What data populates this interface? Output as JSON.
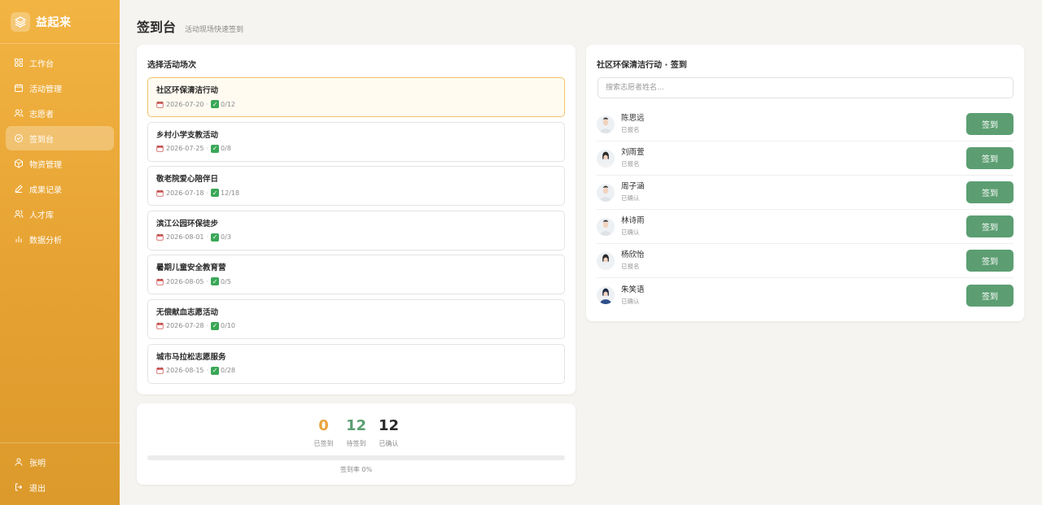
{
  "brand": {
    "name": "益起来",
    "logo_icon": "layers-icon"
  },
  "nav": {
    "items": [
      {
        "label": "工作台",
        "icon": "grid-icon",
        "active": false
      },
      {
        "label": "活动管理",
        "icon": "calendar-icon",
        "active": false
      },
      {
        "label": "志愿者",
        "icon": "users-icon",
        "active": false
      },
      {
        "label": "签到台",
        "icon": "check-circle-icon",
        "active": true
      },
      {
        "label": "物资管理",
        "icon": "box-icon",
        "active": false
      },
      {
        "label": "成果记录",
        "icon": "pen-icon",
        "active": false
      },
      {
        "label": "人才库",
        "icon": "users-icon",
        "active": false
      },
      {
        "label": "数据分析",
        "icon": "bar-chart-icon",
        "active": false
      }
    ]
  },
  "user": {
    "name": "张明",
    "logout_label": "退出"
  },
  "header": {
    "title": "签到台",
    "subtitle": "活动现场快速签到"
  },
  "events": {
    "title": "选择活动场次",
    "items": [
      {
        "name": "社区环保清洁行动",
        "date": "2026-07-20",
        "count": "0/12",
        "selected": true
      },
      {
        "name": "乡村小学支教活动",
        "date": "2026-07-25",
        "count": "0/8",
        "selected": false
      },
      {
        "name": "敬老院爱心陪伴日",
        "date": "2026-07-18",
        "count": "12/18",
        "selected": false
      },
      {
        "name": "滨江公园环保徒步",
        "date": "2026-08-01",
        "count": "0/3",
        "selected": false
      },
      {
        "name": "暑期儿童安全教育营",
        "date": "2026-08-05",
        "count": "0/5",
        "selected": false
      },
      {
        "name": "无偿献血志愿活动",
        "date": "2026-07-28",
        "count": "0/10",
        "selected": false
      },
      {
        "name": "城市马拉松志愿服务",
        "date": "2026-08-15",
        "count": "0/28",
        "selected": false
      }
    ],
    "separator": "·"
  },
  "stats": {
    "checked_in": {
      "value": "0",
      "label": "已签到",
      "color": "#e9a23b"
    },
    "pending": {
      "value": "12",
      "label": "待签到",
      "color": "#5c9e72"
    },
    "confirmed": {
      "value": "12",
      "label": "已确认",
      "color": "#2b2b2b"
    },
    "rate_label": "签到率 0%",
    "rate": 0
  },
  "checkin": {
    "title": "社区环保清洁行动 · 签到",
    "search_placeholder": "搜索志愿者姓名...",
    "button_label": "签到",
    "volunteers": [
      {
        "name": "陈思远",
        "status": "已报名",
        "gender": "m"
      },
      {
        "name": "刘雨萱",
        "status": "已报名",
        "gender": "f"
      },
      {
        "name": "周子涵",
        "status": "已确认",
        "gender": "m"
      },
      {
        "name": "林诗雨",
        "status": "已确认",
        "gender": "m"
      },
      {
        "name": "杨欣怡",
        "status": "已报名",
        "gender": "f"
      },
      {
        "name": "朱笑语",
        "status": "已确认",
        "gender": "f2"
      }
    ]
  },
  "colors": {
    "accent": "#f0ae3c",
    "primary_green": "#5c9e72"
  }
}
